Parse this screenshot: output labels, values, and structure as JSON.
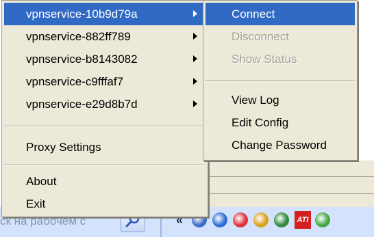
{
  "taskbar": {
    "search_text": "ск на рабочем с",
    "chevron": "«",
    "tray_icons": [
      {
        "icon": "network-globe-icon",
        "color": "#3a6cc8"
      },
      {
        "icon": "network-disconnected-icon",
        "color": "#2f6bd8"
      },
      {
        "icon": "heart-icon",
        "color": "#e0313a"
      },
      {
        "icon": "satellite-dish-icon",
        "color": "#d9a21e"
      },
      {
        "icon": "user-lock-icon",
        "color": "#2e8b3c"
      },
      {
        "icon": "ati-icon",
        "color": "#d41f1f",
        "text": "ATI"
      },
      {
        "icon": "messenger-buddy-icon",
        "color": "#42a843"
      }
    ]
  },
  "main_menu": {
    "items": [
      {
        "label": "vpnservice-10b9d79a",
        "submenu": true,
        "highlighted": true
      },
      {
        "label": "vpnservice-882ff789",
        "submenu": true
      },
      {
        "label": "vpnservice-b8143082",
        "submenu": true
      },
      {
        "label": "vpnservice-c9fffaf7",
        "submenu": true
      },
      {
        "label": "vpnservice-e29d8b7d",
        "submenu": true
      }
    ],
    "proxy": "Proxy Settings",
    "about": "About",
    "exit": "Exit"
  },
  "sub_menu": {
    "connect": "Connect",
    "disconnect": "Disconnect",
    "show_status": "Show Status",
    "view_log": "View Log",
    "edit_config": "Edit Config",
    "change_password": "Change Password"
  },
  "colors": {
    "menu_bg": "#ece9d8",
    "highlight": "#316ac5",
    "disabled_text": "#a19f95"
  }
}
